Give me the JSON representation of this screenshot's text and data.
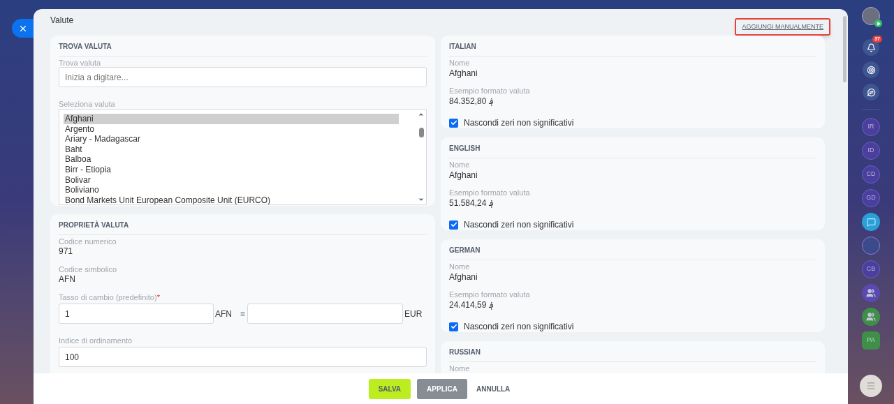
{
  "window": {
    "title": "Valute"
  },
  "add_link": "AGGIUNGI MANUALMENTE",
  "find_card": {
    "heading": "TROVA VALUTA",
    "search": {
      "label": "Trova valuta",
      "placeholder": "Inizia a digitare..."
    },
    "select_label": "Seleziona valuta",
    "options": [
      {
        "label": "Afghani",
        "selected": true
      },
      {
        "label": "Argento",
        "selected": false
      },
      {
        "label": "Ariary - Madagascar",
        "selected": false
      },
      {
        "label": "Baht",
        "selected": false
      },
      {
        "label": "Balboa",
        "selected": false
      },
      {
        "label": "Birr - Etiopia",
        "selected": false
      },
      {
        "label": "Bolivar",
        "selected": false
      },
      {
        "label": "Boliviano",
        "selected": false
      },
      {
        "label": "Bond Markets Unit European Composite Unit (EURCO)",
        "selected": false
      }
    ]
  },
  "properties_card": {
    "heading": "PROPRIETÀ VALUTA",
    "numeric_code": {
      "label": "Codice numerico",
      "value": "971"
    },
    "symbolic_code": {
      "label": "Codice simbolico",
      "value": "AFN"
    },
    "rate": {
      "label": "Tasso di cambio (predefinito)",
      "required_mark": "*",
      "amount": "1",
      "from": "AFN",
      "equals": "=",
      "to": "EUR"
    },
    "sort": {
      "label": "Indice di ordinamento",
      "value": "100"
    }
  },
  "languages": [
    {
      "heading": "ITALIAN",
      "name_label": "Nome",
      "name": "Afghani",
      "format_label": "Esempio formato valuta",
      "format": "84.352,80 ؋",
      "hide_zeros": {
        "label": "Nascondi zeri non significativi",
        "checked": true
      }
    },
    {
      "heading": "ENGLISH",
      "name_label": "Nome",
      "name": "Afghani",
      "format_label": "Esempio formato valuta",
      "format": "51.584,24 ؋",
      "hide_zeros": {
        "label": "Nascondi zeri non significativi",
        "checked": true
      }
    },
    {
      "heading": "GERMAN",
      "name_label": "Nome",
      "name": "Afghani",
      "format_label": "Esempio formato valuta",
      "format": "24.414,59 ؋",
      "hide_zeros": {
        "label": "Nascondi zeri non significativi",
        "checked": true
      }
    },
    {
      "heading": "RUSSIAN",
      "name_label": "Nome"
    }
  ],
  "footer": {
    "save": "SALVA",
    "apply": "APPLICA",
    "cancel": "ANNULLA"
  },
  "sidebar": {
    "notifications": "37",
    "items": [
      {
        "kind": "initials",
        "label": "IR",
        "color": "#4b3f9e"
      },
      {
        "kind": "initials",
        "label": "ID",
        "color": "#4b3f9e"
      },
      {
        "kind": "initials",
        "label": "CD",
        "color": "#4b3f9e"
      },
      {
        "kind": "initials",
        "label": "GD",
        "color": "#4b3f9e"
      },
      {
        "kind": "chat",
        "color": "#2a9fd8"
      },
      {
        "kind": "photo",
        "color": "#3a4a8a"
      },
      {
        "kind": "initials",
        "label": "CB",
        "color": "#4b3f9e"
      },
      {
        "kind": "group",
        "color": "#5a4ab0"
      },
      {
        "kind": "group",
        "color": "#3f8f4a"
      },
      {
        "kind": "hexagon",
        "label": "PA",
        "color": "#3f8f4a"
      }
    ]
  }
}
